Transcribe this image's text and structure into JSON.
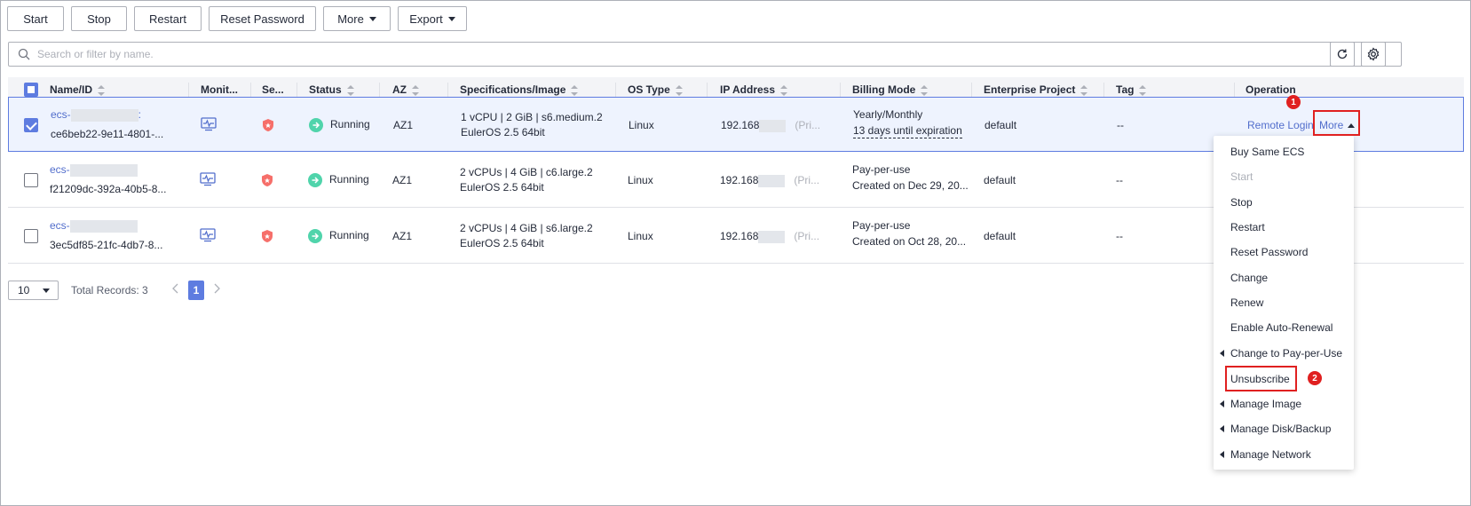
{
  "toolbar": {
    "start": "Start",
    "stop": "Stop",
    "restart": "Restart",
    "reset_password": "Reset Password",
    "more": "More",
    "export": "Export"
  },
  "search": {
    "placeholder": "Search or filter by name."
  },
  "table": {
    "headers": {
      "name": "Name/ID",
      "monitoring": "Monit...",
      "security": "Se...",
      "status": "Status",
      "az": "AZ",
      "specs": "Specifications/Image",
      "os": "OS Type",
      "ip": "IP Address",
      "billing": "Billing Mode",
      "project": "Enterprise Project",
      "tag": "Tag",
      "operation": "Operation"
    },
    "rows": [
      {
        "name_prefix": "ecs-",
        "name_suffix": ":",
        "id": "ce6beb22-9e11-4801-...",
        "status": "Running",
        "az": "AZ1",
        "spec": "1 vCPU | 2 GiB | s6.medium.2",
        "image": "EulerOS 2.5 64bit",
        "os": "Linux",
        "ip": "192.168",
        "ip_note": "(Pri...",
        "billing": "Yearly/Monthly",
        "billing_note": "13 days until expiration",
        "project": "default",
        "tag": "--",
        "op_login": "Remote Login",
        "op_more": "More"
      },
      {
        "name_prefix": "ecs-",
        "name_suffix": "",
        "id": "f21209dc-392a-40b5-8...",
        "status": "Running",
        "az": "AZ1",
        "spec": "2 vCPUs | 4 GiB | c6.large.2",
        "image": "EulerOS 2.5 64bit",
        "os": "Linux",
        "ip": "192.168",
        "ip_note": "(Pri...",
        "billing": "Pay-per-use",
        "billing_note": "Created on Dec 29, 20...",
        "project": "default",
        "tag": "--"
      },
      {
        "name_prefix": "ecs-",
        "name_suffix": "",
        "id": "3ec5df85-21fc-4db7-8...",
        "status": "Running",
        "az": "AZ1",
        "spec": "2 vCPUs | 4 GiB | s6.large.2",
        "image": "EulerOS 2.5 64bit",
        "os": "Linux",
        "ip": "192.168",
        "ip_note": "(Pri...",
        "billing": "Pay-per-use",
        "billing_note": "Created on Oct 28, 20...",
        "project": "default",
        "tag": "--"
      }
    ]
  },
  "dropdown": {
    "items": [
      "Buy Same ECS",
      "Start",
      "Stop",
      "Restart",
      "Reset Password",
      "Change",
      "Renew",
      "Enable Auto-Renewal",
      "Change to Pay-per-Use",
      "Unsubscribe",
      "Manage Image",
      "Manage Disk/Backup",
      "Manage Network"
    ]
  },
  "annotations": {
    "badge1": "1",
    "badge2": "2"
  },
  "pagination": {
    "page_size": "10",
    "total": "Total Records: 3",
    "current_page": "1"
  },
  "colors": {
    "accent": "#5e7ce0",
    "link": "#526ecc",
    "running": "#50d4ab",
    "security": "#f66f6a",
    "highlight": "#e02020"
  }
}
